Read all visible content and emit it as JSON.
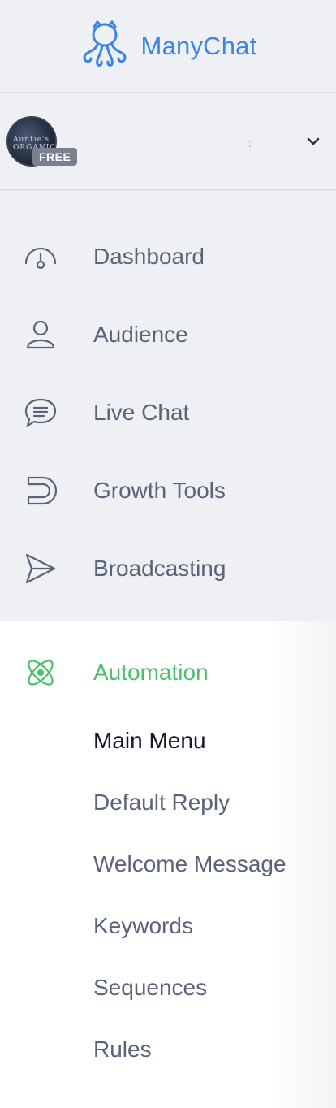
{
  "brand": {
    "name": "ManyChat",
    "color": "#3c85e6"
  },
  "account": {
    "avatar_text": "Auntie's ORGANICS",
    "plan_badge": "FREE",
    "name_placeholder": ":"
  },
  "nav": {
    "items": [
      {
        "label": "Dashboard",
        "icon": "gauge-icon"
      },
      {
        "label": "Audience",
        "icon": "user-icon"
      },
      {
        "label": "Live Chat",
        "icon": "chat-bubble-icon"
      },
      {
        "label": "Growth Tools",
        "icon": "magnet-icon"
      },
      {
        "label": "Broadcasting",
        "icon": "send-icon"
      }
    ],
    "automation": {
      "label": "Automation",
      "icon": "atom-icon",
      "color": "#4cbf6b",
      "subitems": [
        {
          "label": "Main Menu",
          "active": true
        },
        {
          "label": "Default Reply"
        },
        {
          "label": "Welcome Message"
        },
        {
          "label": "Keywords"
        },
        {
          "label": "Sequences"
        },
        {
          "label": "Rules"
        }
      ]
    }
  }
}
